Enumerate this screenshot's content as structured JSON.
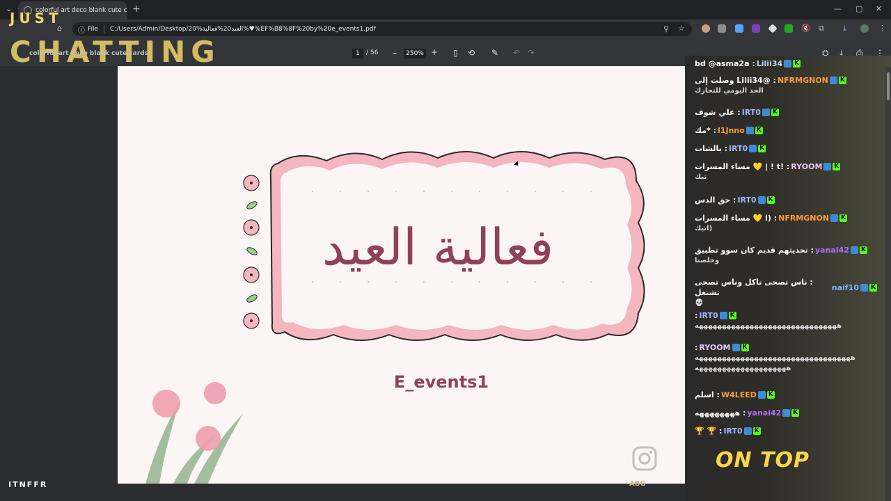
{
  "browser": {
    "tab_title": "colorful art deco blank cute cards",
    "tab_close": "✕",
    "new_tab": "+",
    "scheme_label": "File",
    "url": "C:/Users/Admin/Desktop/20%العيد20%فعالية%♥%EF%B8%8F%20by%20e_events1.pdf"
  },
  "pdf_toolbar": {
    "current_page": "1",
    "total_pages": "/ 56",
    "zoom": "250%",
    "zoom_out": "–",
    "zoom_in": "+",
    "undo": "↶",
    "redo": "↷"
  },
  "pdf_content": {
    "title": "فعالية العيد",
    "subtitle": "E_events1",
    "frame_color": "#f4b6bf",
    "text_color": "#8f4257"
  },
  "overlay": {
    "just": "JUST",
    "chatting": "CHATTING",
    "on_top": "ON TOP",
    "brand": "ITNFFR",
    "watermark": "ABG",
    "faded_title": "colorful art deco blank cute cards"
  },
  "chat": [
    {
      "user": "Lilii34",
      "text": ": bd @asma2a",
      "color": "#b8d9f5"
    },
    {
      "user": "NFRMGNON",
      "text": ": @Lilii34 وصلت إلى",
      "cont": "الحد اليومي للتحارك",
      "color": "#ff9a3c"
    },
    {
      "user": "IRT0",
      "text": ": علي شوف",
      "color": "#9fb7ff"
    },
    {
      "user": "l1Jnno",
      "text": ": *مك",
      "color": "#ff9a3c"
    },
    {
      "user": "IRT0",
      "text": ": بالشات",
      "color": "#9fb7ff"
    },
    {
      "user": "RYOOM",
      "text": ": !t ! | 💛 مساء المسرات",
      "cont": "تيك",
      "color": "#e6c7ff"
    },
    {
      "user": "IRT0",
      "text": ": حق الدس",
      "color": "#9fb7ff"
    },
    {
      "user": "NFRMGNON",
      "text": ": (ا 💛 مساء المسرات",
      "cont": "(اتيك",
      "color": "#ff9a3c"
    },
    {
      "user": "yanai42",
      "text": ": تحديثهم قديم كان سوو تطبيق",
      "cont": "وخلصنا",
      "color": "#b36bff"
    },
    {
      "user": "naif10",
      "text": ": ناس تصحى تاكل وناس تصحى تشتغل",
      "cont": "💀",
      "color": "#7fb6ff"
    },
    {
      "user": "IRT0",
      "text": ":",
      "cont": "هههههههههههههههههههههههههههههههه",
      "color": "#9fb7ff"
    },
    {
      "user": "RYOOM",
      "text": ":",
      "cont": "ههههههههههههههههههههههههههههههههههه",
      "cont2": "ههههههههههههههههههههه",
      "color": "#e6c7ff"
    },
    {
      "user": "W4LEED",
      "text": ": اسلم",
      "color": "#ff9a3c"
    },
    {
      "user": "yanai42",
      "text": ": ههههههههه",
      "color": "#b36bff"
    },
    {
      "user": "IRT0",
      "text": ": 🏆 🏆",
      "color": "#9fb7ff"
    }
  ]
}
